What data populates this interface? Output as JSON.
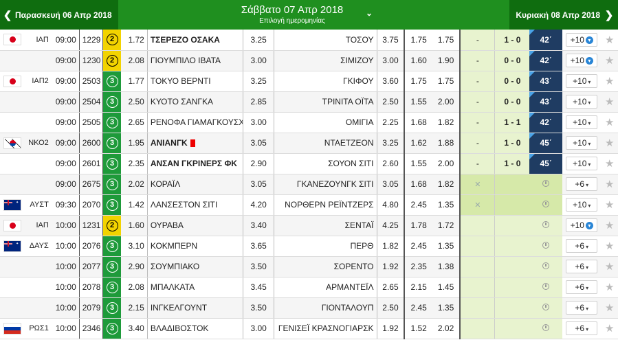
{
  "header": {
    "prev_label": "Παρασκευή 06 Απρ 2018",
    "title": "Σάββατο 07 Απρ 2018",
    "subtitle": "Επιλογή ημερομηνίας",
    "next_label": "Κυριακή 08 Απρ 2018",
    "prev_arrow": "❮",
    "next_arrow": "❯",
    "chevron": "⌄"
  },
  "rows": [
    {
      "flag": "jp",
      "league": "ΙΑΠ",
      "time": "09:00",
      "code": "1229",
      "badge": "2",
      "o1": "1.72",
      "home": "ΤΣΕΡΕΖΟ ΟΣΑΚΑ",
      "home_bold": true,
      "ox": "3.25",
      "away": "ΤΟΣΟΥ",
      "o2": "3.75",
      "u1": "1.75",
      "u2": "1.75",
      "dash": "-",
      "score": "1 - 0",
      "minute": "42΄",
      "live": true,
      "more": "+10",
      "dl": true
    },
    {
      "flag": "",
      "league": "",
      "time": "09:00",
      "code": "1230",
      "badge": "2",
      "o1": "2.08",
      "home": "ΓΙΟΥΜΠΙΛΟ ΙΒΑΤΑ",
      "home_bold": false,
      "ox": "3.00",
      "away": "ΣΙΜΙΖΟΥ",
      "o2": "3.00",
      "u1": "1.60",
      "u2": "1.90",
      "dash": "-",
      "score": "0 - 0",
      "minute": "42΄",
      "live": true,
      "more": "+10",
      "dl": true
    },
    {
      "flag": "jp",
      "league": "ΙΑΠ2",
      "time": "09:00",
      "code": "2503",
      "badge": "3",
      "o1": "1.77",
      "home": "ΤΟΚΥΟ ΒΕΡΝΤΙ",
      "home_bold": false,
      "ox": "3.25",
      "away": "ΓΚΙΦΟΥ",
      "o2": "3.60",
      "u1": "1.75",
      "u2": "1.75",
      "dash": "-",
      "score": "0 - 0",
      "minute": "43΄",
      "live": true,
      "more": "+10",
      "dl": false
    },
    {
      "flag": "",
      "league": "",
      "time": "09:00",
      "code": "2504",
      "badge": "3",
      "o1": "2.50",
      "home": "ΚΥΟΤΟ ΣΑΝΓΚΑ",
      "home_bold": false,
      "ox": "2.85",
      "away": "ΤΡΙΝΙΤΑ ΟΪΤΑ",
      "o2": "2.50",
      "u1": "1.55",
      "u2": "2.00",
      "dash": "-",
      "score": "0 - 0",
      "minute": "43΄",
      "live": true,
      "more": "+10",
      "dl": false
    },
    {
      "flag": "",
      "league": "",
      "time": "09:00",
      "code": "2505",
      "badge": "3",
      "o1": "2.65",
      "home": "ΡΕΝΟΦΑ ΓΙΑΜΑΓΚΟΥΣΧΙ",
      "home_bold": false,
      "ox": "3.00",
      "away": "ΟΜΙΓΙΑ",
      "o2": "2.25",
      "u1": "1.68",
      "u2": "1.82",
      "dash": "-",
      "score": "1 - 1",
      "minute": "42΄",
      "live": true,
      "more": "+10",
      "dl": false
    },
    {
      "flag": "kr",
      "league": "ΝΚΟ2",
      "time": "09:00",
      "code": "2600",
      "badge": "3",
      "o1": "1.95",
      "home": "ΑΝΙΑΝΓΚ",
      "home_bold": true,
      "red": true,
      "ox": "3.05",
      "away": "ΝΤΑΕΤΖΕΟΝ",
      "o2": "3.25",
      "u1": "1.62",
      "u2": "1.88",
      "dash": "-",
      "score": "1 - 0",
      "minute": "45΄",
      "live": true,
      "more": "+10",
      "dl": false
    },
    {
      "flag": "",
      "league": "",
      "time": "09:00",
      "code": "2601",
      "badge": "3",
      "o1": "2.35",
      "home": "ΑΝΣΑΝ ΓΚΡΙΝΕΡΣ ΦΚ",
      "home_bold": true,
      "ox": "2.90",
      "away": "ΣΟΥΟΝ ΣΙΤΙ",
      "o2": "2.60",
      "u1": "1.55",
      "u2": "2.00",
      "dash": "-",
      "score": "1 - 0",
      "minute": "45΄",
      "live": true,
      "more": "+10",
      "dl": false
    },
    {
      "flag": "",
      "league": "",
      "time": "09:00",
      "code": "2675",
      "badge": "3",
      "o1": "2.02",
      "home": "ΚΟΡΑΪΛ",
      "home_bold": false,
      "ox": "3.05",
      "away": "ΓΚΑΝΕΖΟΥΝΓΚ ΣΙΤΙ",
      "o2": "3.05",
      "u1": "1.68",
      "u2": "1.82",
      "dash": "",
      "score": "",
      "lgn": true,
      "fade": true,
      "minute": "",
      "live": false,
      "more": "+6",
      "dl": false
    },
    {
      "flag": "au",
      "league": "ΑΥΣΤ",
      "time": "09:30",
      "code": "2070",
      "badge": "3",
      "o1": "1.42",
      "home": "ΛΑΝΣΕΣΤΟΝ ΣΙΤΙ",
      "home_bold": false,
      "ox": "4.20",
      "away": "ΝΟΡΘΕΡΝ ΡΕΪΝΤΖΕΡΣ",
      "o2": "4.80",
      "u1": "2.45",
      "u2": "1.35",
      "dash": "",
      "score": "",
      "lgn": true,
      "fade": true,
      "minute": "",
      "live": false,
      "more": "+10",
      "dl": false
    },
    {
      "flag": "jp",
      "league": "ΙΑΠ",
      "time": "10:00",
      "code": "1231",
      "badge": "2",
      "o1": "1.60",
      "home": "ΟΥΡΑΒΑ",
      "home_bold": false,
      "ox": "3.40",
      "away": "ΣΕΝΤΑΪ",
      "o2": "4.25",
      "u1": "1.78",
      "u2": "1.72",
      "dash": "",
      "score": "",
      "minute": "",
      "live": false,
      "more": "+10",
      "dl": true
    },
    {
      "flag": "au",
      "league": "ΔΑΥΣ",
      "time": "10:00",
      "code": "2076",
      "badge": "3",
      "o1": "3.10",
      "home": "ΚΟΚΜΠΕΡΝ",
      "home_bold": false,
      "ox": "3.65",
      "away": "ΠΕΡΘ",
      "o2": "1.82",
      "u1": "2.45",
      "u2": "1.35",
      "dash": "",
      "score": "",
      "minute": "",
      "live": false,
      "more": "+6",
      "dl": false
    },
    {
      "flag": "",
      "league": "",
      "time": "10:00",
      "code": "2077",
      "badge": "3",
      "o1": "2.90",
      "home": "ΣΟΥΜΠΙΑΚΟ",
      "home_bold": false,
      "ox": "3.50",
      "away": "ΣΟΡΕΝΤΟ",
      "o2": "1.92",
      "u1": "2.35",
      "u2": "1.38",
      "dash": "",
      "score": "",
      "minute": "",
      "live": false,
      "more": "+6",
      "dl": false
    },
    {
      "flag": "",
      "league": "",
      "time": "10:00",
      "code": "2078",
      "badge": "3",
      "o1": "2.08",
      "home": "ΜΠΑΛΚΑΤΑ",
      "home_bold": false,
      "ox": "3.45",
      "away": "ΑΡΜΑΝΤΕΪΛ",
      "o2": "2.65",
      "u1": "2.15",
      "u2": "1.45",
      "dash": "",
      "score": "",
      "minute": "",
      "live": false,
      "more": "+6",
      "dl": false
    },
    {
      "flag": "",
      "league": "",
      "time": "10:00",
      "code": "2079",
      "badge": "3",
      "o1": "2.15",
      "home": "ΙΝΓΚΕΛΓΟΥΝΤ",
      "home_bold": false,
      "ox": "3.50",
      "away": "ΓΙΟΝΤΑΛΟΥΠ",
      "o2": "2.50",
      "u1": "2.45",
      "u2": "1.35",
      "dash": "",
      "score": "",
      "minute": "",
      "live": false,
      "more": "+6",
      "dl": false
    },
    {
      "flag": "ru",
      "league": "ΡΩΣ1",
      "time": "10:00",
      "code": "2346",
      "badge": "3",
      "o1": "3.40",
      "home": "ΒΛΑΔΙΒΟΣΤΟΚ",
      "home_bold": false,
      "ox": "3.00",
      "away": "ΓΕΝΙΣΕΪ ΚΡΑΣΝΟΓΙΑΡΣΚ",
      "o2": "1.92",
      "u1": "1.52",
      "u2": "2.02",
      "dash": "",
      "score": "",
      "minute": "",
      "live": false,
      "more": "+6",
      "dl": false
    }
  ],
  "icons": {
    "star": "★",
    "download": "▾",
    "caret": "▾",
    "fade": "✕"
  }
}
